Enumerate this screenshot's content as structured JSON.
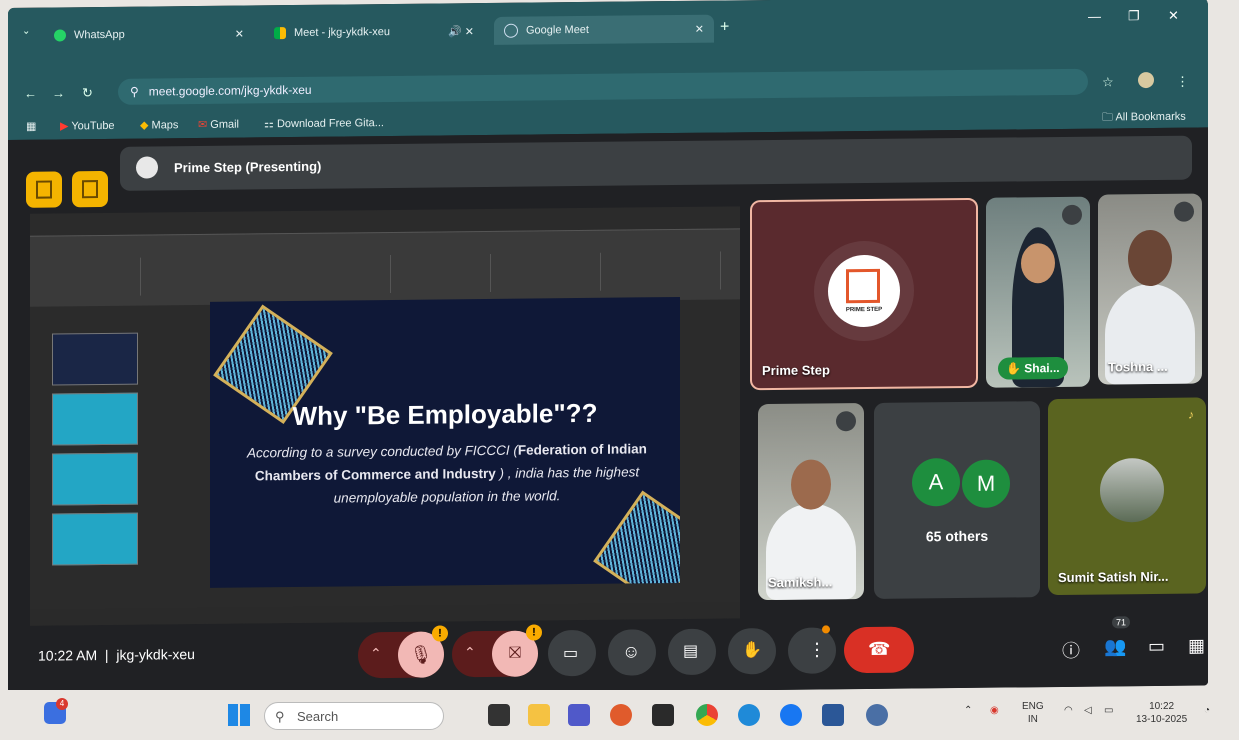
{
  "browser": {
    "tabs": [
      {
        "label": "WhatsApp",
        "icon": "whatsapp-icon"
      },
      {
        "label": "Meet - jkg-ykdk-xeu",
        "icon": "meet-icon"
      },
      {
        "label": "Google Meet",
        "icon": "meet-icon"
      }
    ],
    "url": "meet.google.com/jkg-ykdk-xeu",
    "all_bookmarks": "All Bookmarks",
    "bookmarks": [
      "YouTube",
      "Maps",
      "Gmail",
      "Download Free Gita..."
    ]
  },
  "meet": {
    "presenting_label": "Prime Step (Presenting)",
    "slide": {
      "title": "Why \"Be Employable\"??",
      "body_before_bold": "According to a survey conducted by FICCCI (",
      "body_bold": "Federation of Indian Chambers of Commerce and Industry",
      "body_after_bold": " ) , india has the highest unemployable population in the world."
    },
    "participants": [
      {
        "name": "Prime Step",
        "logo_text": "PRIME STEP"
      },
      {
        "name": "Shai..."
      },
      {
        "name": "Toshna ..."
      },
      {
        "name": "Samiksh..."
      },
      {
        "name": "Sumit Satish Nir..."
      }
    ],
    "others": {
      "initials": [
        "A",
        "M"
      ],
      "label": "65 others"
    },
    "bottom": {
      "time": "10:22 AM",
      "meeting_code": "jkg-ykdk-xeu",
      "people_count": "71",
      "warning_mark": "!"
    }
  },
  "taskbar": {
    "search_placeholder": "Search",
    "lang_top": "ENG",
    "lang_bottom": "IN",
    "clock_time": "10:22",
    "clock_date": "13-10-2025",
    "notification_badge": "4"
  }
}
